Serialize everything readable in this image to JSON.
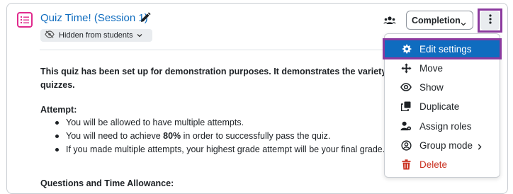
{
  "activity": {
    "title": "Quiz Time! (Session 1)",
    "visibility_badge": "Hidden from students"
  },
  "description": {
    "intro_line1": "This quiz has been set up for demonstration purposes. It demonstrates the variety of qu",
    "intro_line2": "quizzes.",
    "attempt_heading": "Attempt:",
    "bullets": [
      {
        "pre": "You will be allowed to have multiple attempts.",
        "bold": "",
        "post": ""
      },
      {
        "pre": "You will need to achieve ",
        "bold": "80%",
        "post": " in order to successfully pass the quiz."
      },
      {
        "pre": "If you made multiple attempts, your highest grade attempt will be your final grade.",
        "bold": "",
        "post": ""
      }
    ],
    "questions_heading": "Questions and Time Allowance:"
  },
  "toolbar": {
    "completion_label": "Completion",
    "groups_icon": "people-icon",
    "actions_icon": "kebab-icon"
  },
  "menu": {
    "items": [
      {
        "label": "Edit settings",
        "icon": "gear-icon"
      },
      {
        "label": "Move",
        "icon": "move-icon"
      },
      {
        "label": "Show",
        "icon": "eye-icon"
      },
      {
        "label": "Duplicate",
        "icon": "copy-icon"
      },
      {
        "label": "Assign roles",
        "icon": "user-cog-icon"
      },
      {
        "label": "Group mode",
        "icon": "user-circle-icon"
      },
      {
        "label": "Delete",
        "icon": "trash-icon"
      }
    ]
  },
  "colors": {
    "link": "#0f6cbf",
    "accent_quiz": "#e02a8d",
    "highlight": "#8b3a9e",
    "danger": "#ca3120"
  }
}
